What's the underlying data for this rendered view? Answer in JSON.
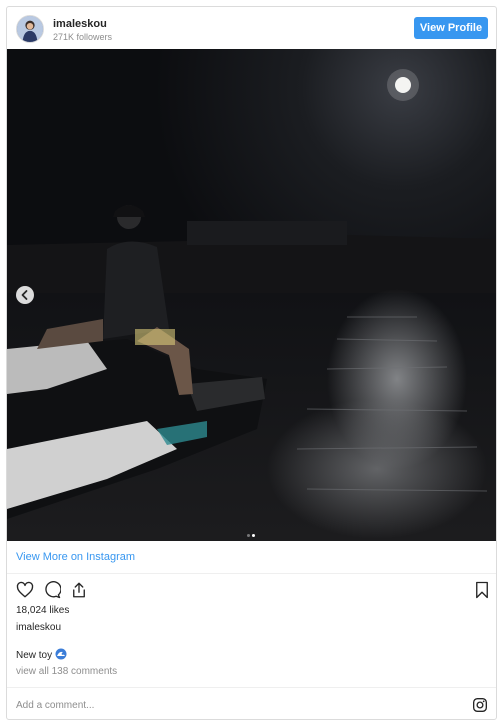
{
  "header": {
    "username": "imaleskou",
    "followers": "271K followers",
    "view_profile_label": "View Profile"
  },
  "media": {
    "carousel_total": 2,
    "carousel_active": 2,
    "icons": {
      "prev": "chevron-left-icon"
    }
  },
  "view_more_label": "View More on Instagram",
  "actions": {
    "icons": [
      "heart-icon",
      "comment-icon",
      "share-icon",
      "bookmark-icon"
    ]
  },
  "likes": "18,024 likes",
  "owner": "imaleskou",
  "caption": {
    "text": "New toy",
    "emoji_icon": "wave-icon"
  },
  "comments_link": "view all 138 comments",
  "add_comment_placeholder": "Add a comment...",
  "footer_icon": "instagram-icon",
  "colors": {
    "accent": "#3897f0",
    "text": "#262626",
    "muted": "#8e8e8e",
    "border": "#dbdbdb"
  }
}
